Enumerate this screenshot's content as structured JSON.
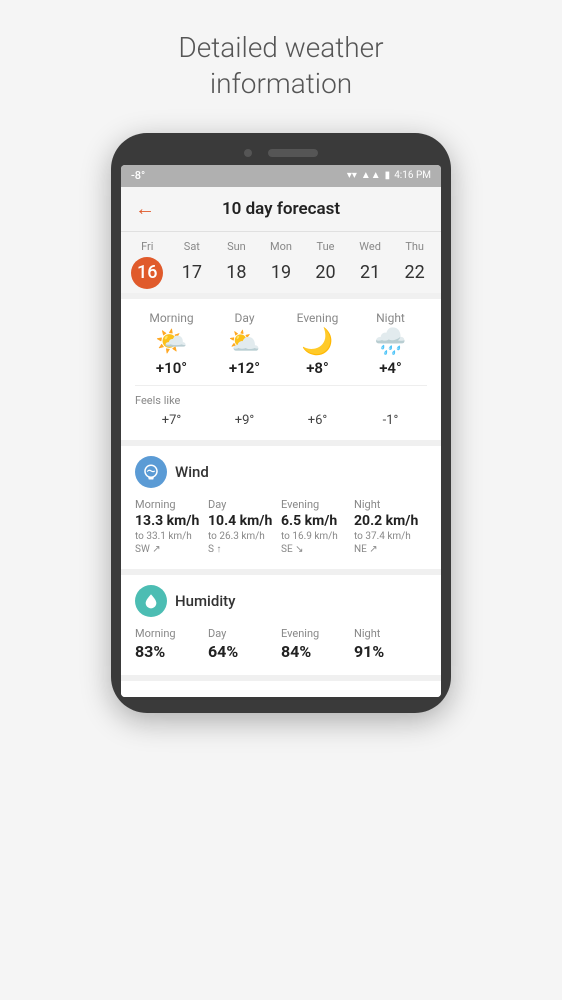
{
  "page": {
    "title_line1": "Detailed weather",
    "title_line2": "information"
  },
  "status_bar": {
    "temp": "-8°",
    "time": "4:16 PM",
    "wifi": "▾",
    "signal": "▲",
    "battery": "▮"
  },
  "header": {
    "back_label": "←",
    "title": "10 day forecast"
  },
  "days": [
    {
      "name": "Fri",
      "num": "16",
      "active": true
    },
    {
      "name": "Sat",
      "num": "17",
      "active": false
    },
    {
      "name": "Sun",
      "num": "18",
      "active": false
    },
    {
      "name": "Mon",
      "num": "19",
      "active": false
    },
    {
      "name": "Tue",
      "num": "20",
      "active": false
    },
    {
      "name": "Wed",
      "num": "21",
      "active": false
    },
    {
      "name": "Thu",
      "num": "22",
      "active": false
    }
  ],
  "time_periods": [
    "Morning",
    "Day",
    "Evening",
    "Night"
  ],
  "weather_icons": [
    "🌤️",
    "⛅",
    "🌙☁️",
    "🌧️"
  ],
  "temps": [
    "+10°",
    "+12°",
    "+8°",
    "+4°"
  ],
  "feels_like_label": "Feels like",
  "feels_like": [
    "+7°",
    "+9°",
    "+6°",
    "-1°"
  ],
  "wind": {
    "title": "Wind",
    "labels": [
      "Morning",
      "Day",
      "Evening",
      "Night"
    ],
    "speeds": [
      "13.3 km/h",
      "10.4 km/h",
      "6.5 km/h",
      "20.2 km/h"
    ],
    "ranges": [
      "to 33.1 km/h",
      "to 26.3 km/h",
      "to 16.9 km/h",
      "to 37.4 km/h"
    ],
    "directions": [
      "SW ↗",
      "S ↑",
      "SE ↘",
      "NE ↗"
    ]
  },
  "humidity": {
    "title": "Humidity",
    "labels": [
      "Morning",
      "Day",
      "Evening",
      "Night"
    ],
    "values": [
      "83%",
      "64%",
      "84%",
      "91%"
    ]
  }
}
